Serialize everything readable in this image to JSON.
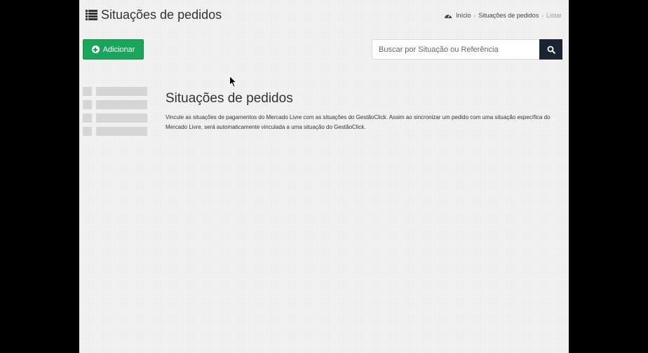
{
  "header": {
    "title": "Situações de pedidos",
    "title_icon": "list-icon",
    "breadcrumb": {
      "home_icon": "dashboard-icon",
      "home": "Início",
      "section": "Situações de pedidos",
      "current": "Listar",
      "separator": "›"
    }
  },
  "toolbar": {
    "add_label": "Adicionar",
    "add_icon": "plus-circle-icon",
    "search_placeholder": "Buscar por Situação ou Referência",
    "search_value": "",
    "search_icon": "search-icon"
  },
  "empty_state": {
    "title": "Situações de pedidos",
    "description": "Vincule as situações de pagamentos do Mercado Livre com as situações do GestãoClick. Assim ao sincronizar um pedido com uma situação específica do Mercado Livre, será automaticamente vinculada a uma situação do GestãoClick."
  },
  "colors": {
    "primary_green": "#19a55a",
    "search_button": "#1a2433",
    "placeholder_gray": "#d6d6d6",
    "background": "#f2f2f2"
  }
}
